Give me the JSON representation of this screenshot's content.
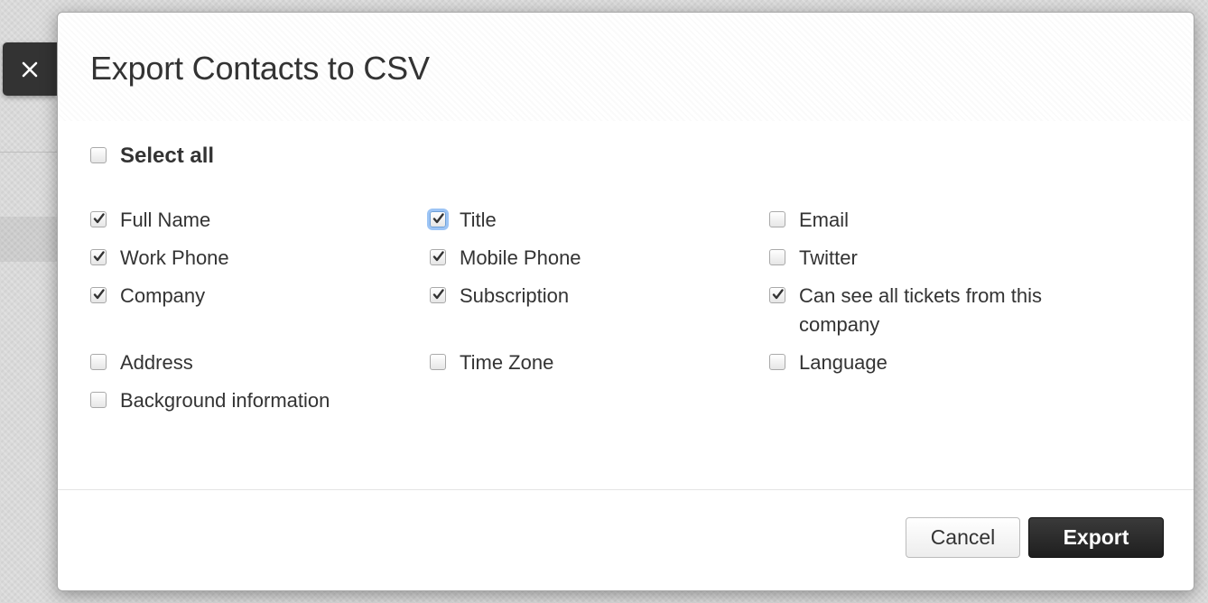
{
  "dialog": {
    "title": "Export Contacts to CSV",
    "select_all": {
      "label": "Select all",
      "checked": false
    },
    "fields": [
      {
        "label": "Full Name",
        "checked": true
      },
      {
        "label": "Title",
        "checked": true,
        "focused": true
      },
      {
        "label": "Email",
        "checked": false
      },
      {
        "label": "Work Phone",
        "checked": true
      },
      {
        "label": "Mobile Phone",
        "checked": true
      },
      {
        "label": "Twitter",
        "checked": false
      },
      {
        "label": "Company",
        "checked": true
      },
      {
        "label": "Subscription",
        "checked": true
      },
      {
        "label": "Can see all tickets from this company",
        "checked": true
      },
      {
        "label": "Address",
        "checked": false
      },
      {
        "label": "Time Zone",
        "checked": false
      },
      {
        "label": "Language",
        "checked": false
      },
      {
        "label": "Background information",
        "checked": false
      }
    ],
    "buttons": {
      "cancel_label": "Cancel",
      "export_label": "Export"
    }
  },
  "close": {
    "icon": "close-icon",
    "glyph": "×"
  },
  "colors": {
    "primary_button": "#2b2b2b",
    "focus_ring": "#9cc4f5",
    "text": "#333333"
  }
}
